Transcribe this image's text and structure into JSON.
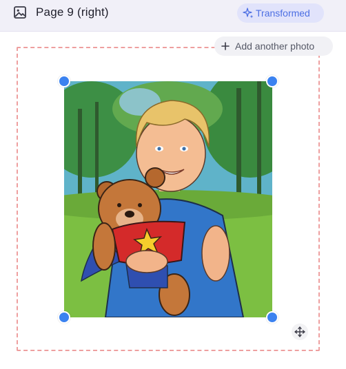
{
  "header": {
    "title": "Page 9 (right)",
    "badge_label": "Transformed",
    "icon": "image-icon",
    "badge_icon": "sparkle-icon"
  },
  "actions": {
    "add_photo_label": "Add another photo",
    "add_icon": "plus-icon",
    "move_icon": "move-icon"
  },
  "photo": {
    "subject": "cartoon boy with teddy bear"
  },
  "colors": {
    "accent": "#3b82f0",
    "badge_text": "#4c6fe3",
    "dashed_border": "#ee9f9f"
  }
}
